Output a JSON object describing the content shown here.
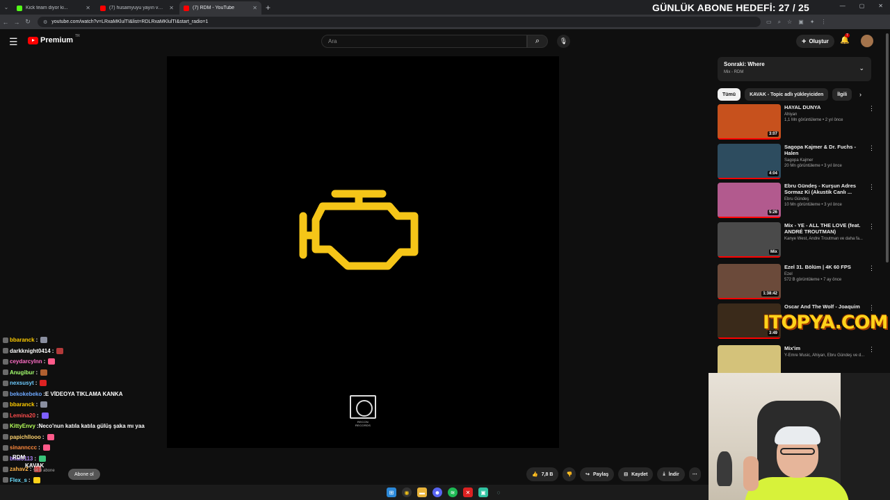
{
  "browser": {
    "tabs": [
      {
        "title": "Kick team diyor ki...",
        "color": "#53fc18",
        "active": false
      },
      {
        "title": "(7) husamyuyu yayın vakti 16 ·",
        "color": "#ff0000",
        "active": false
      },
      {
        "title": "(7) RDM - YouTube",
        "color": "#ff0000",
        "active": true
      }
    ],
    "new_tab": "+",
    "url": "youtube.com/watch?v=LRxaMKlulTI&list=RDLRxaMKlulTI&start_radio=1"
  },
  "stream_overlay": {
    "goal_text": "GÜNLÜK ABONE HEDEFİ: 27 / 25",
    "brand_banner": "ITOPYA.COM"
  },
  "youtube": {
    "logo_text": "Premium",
    "logo_region": "TR",
    "search_placeholder": "Ara",
    "create_label": "Oluştur",
    "notification_count": "7",
    "channel_name": "RDM",
    "uploader_name": "KAVAK",
    "subscriber_text": "54 B abone",
    "subscribe_label": "Abone ol",
    "actions": {
      "likes": "7,8 B",
      "share": "Paylaş",
      "save": "Kaydet",
      "download": "İndir"
    },
    "up_next": {
      "title": "Sonraki: Where",
      "subtitle": "Mix - RDM"
    },
    "chips": [
      {
        "label": "Tümü",
        "selected": true
      },
      {
        "label": "KAVAK - Topic adlı yükleyiciden",
        "selected": false
      },
      {
        "label": "İlgili",
        "selected": false
      }
    ],
    "recommendations": [
      {
        "title": "HAYAL DUNYA",
        "channel": "Ahiyan",
        "views": "1,1 Mn görüntüleme • 2 yıl önce",
        "duration": "3:07",
        "thumb": "#c7511d"
      },
      {
        "title": "Sagopa Kajmer & Dr. Fuchs - Halen",
        "channel": "Sagopa Kajmer",
        "views": "20 Mn görüntüleme • 3 yıl önce",
        "duration": "4:04",
        "thumb": "#2d4c5f"
      },
      {
        "title": "Ebru Gündeş - Kurşun Adres Sormaz Ki (Akustik Canlı ...",
        "channel": "Ebru Gündeş",
        "views": "10 Mn görüntüleme • 3 yıl önce",
        "duration": "5:26",
        "thumb": "#b25a8e"
      },
      {
        "title": "Mix - YE - ALL THE LOVE (feat. ANDRÉ TROUTMAN)",
        "channel": "Kanye West, Andre Troutman ve daha fa...",
        "views": "",
        "duration": "Mix",
        "thumb": "#4a4a4a"
      },
      {
        "title": "Ezel 31. Bölüm | 4K 60 FPS",
        "channel": "Ezel",
        "views": "572 B görüntüleme • 7 ay önce",
        "duration": "1:38:42",
        "thumb": "#6b4a3a"
      },
      {
        "title": "Oscar And The Wolf - Joaquim",
        "channel": "",
        "views": "",
        "duration": "3:49",
        "thumb": "#3a2a1a"
      },
      {
        "title": "Mix'im",
        "channel": "Y-Emre Music, Ahiyan, Ebru Gündeş ve d...",
        "views": "",
        "duration": "",
        "thumb": "#d4c27a"
      }
    ]
  },
  "chat": [
    {
      "user": "bbaranck",
      "msg": "",
      "color": "#ffcc00",
      "emote": "#8a8fa0"
    },
    {
      "user": "darkknight0414",
      "msg": "",
      "color": "#ffffff",
      "emote": "#b33a3a"
    },
    {
      "user": "ceydarcylnn",
      "msg": "",
      "color": "#ff6ec7",
      "emote": "#ff5a8a"
    },
    {
      "user": "Anugibur",
      "msg": "",
      "color": "#a3ff6e",
      "emote": "#b06030"
    },
    {
      "user": "nexsusyt",
      "msg": "",
      "color": "#6ecbff",
      "emote": "#d22"
    },
    {
      "user": "bekokebeko",
      "msg": "E VİDEOYA TIKLAMA KANKA",
      "color": "#6ea8ff",
      "emote": ""
    },
    {
      "user": "bbaranck",
      "msg": "",
      "color": "#ffcc00",
      "emote": "#8a8fa0"
    },
    {
      "user": "Lemina20",
      "msg": "",
      "color": "#ff4d4d",
      "emote": "#7d5fff"
    },
    {
      "user": "KittyEnvy",
      "msg": "Neco'nun katıla katıla gülüş şaka mı yaa",
      "color": "#b6ff5a",
      "emote": ""
    },
    {
      "user": "papichllooo",
      "msg": "",
      "color": "#ffd36e",
      "emote": "#ff5a8a"
    },
    {
      "user": "sinannccc",
      "msg": "",
      "color": "#ff8a3d",
      "emote": "#ff5a8a"
    },
    {
      "user": "bilal3113",
      "msg": "",
      "color": "#b388ff",
      "emote": "#3ac27a"
    },
    {
      "user": "zahav2",
      "msg": "",
      "color": "#ffb347",
      "emote": "#c04040"
    },
    {
      "user": "Flex_s",
      "msg": "",
      "color": "#6ee0ff",
      "emote": "#ffd21a"
    }
  ],
  "video": {
    "label": "RECON RECORDS"
  }
}
